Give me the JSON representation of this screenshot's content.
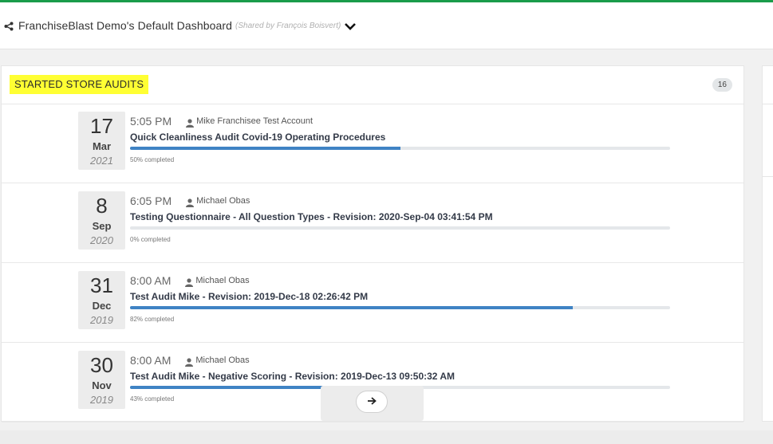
{
  "header": {
    "title": "FranchiseBlast Demo's Default Dashboard",
    "shared_by": "(Shared by François Boisvert)",
    "icons": {
      "share": "share-icon",
      "chevron": "chevron-down-icon"
    }
  },
  "colors": {
    "top_bar": "#1a9c4a",
    "highlight": "#ffff33",
    "progress": "#3f83c4"
  },
  "panel": {
    "title": "STARTED STORE AUDITS",
    "count": "16",
    "audits": [
      {
        "day": "17",
        "month": "Mar",
        "year": "2021",
        "time": "5:05 PM",
        "user": "Mike Franchisee Test Account",
        "title": "Quick Cleanliness Audit Covid-19 Operating Procedures",
        "progress_pct": 50,
        "progress_label": "50% completed"
      },
      {
        "day": "8",
        "month": "Sep",
        "year": "2020",
        "time": "6:05 PM",
        "user": "Michael Obas",
        "title": "Testing Questionnaire - All Question Types - Revision: 2020-Sep-04 03:41:54 PM",
        "progress_pct": 0,
        "progress_label": "0% completed"
      },
      {
        "day": "31",
        "month": "Dec",
        "year": "2019",
        "time": "8:00 AM",
        "user": "Michael Obas",
        "title": "Test Audit Mike - Revision: 2019-Dec-18 02:26:42 PM",
        "progress_pct": 82,
        "progress_label": "82% completed"
      },
      {
        "day": "30",
        "month": "Nov",
        "year": "2019",
        "time": "8:00 AM",
        "user": "Michael Obas",
        "title": "Test Audit Mike - Negative Scoring - Revision: 2019-Dec-13 09:50:32 AM",
        "progress_pct": 43,
        "progress_label": "43% completed"
      }
    ],
    "next_icon": "arrow-right-icon"
  }
}
